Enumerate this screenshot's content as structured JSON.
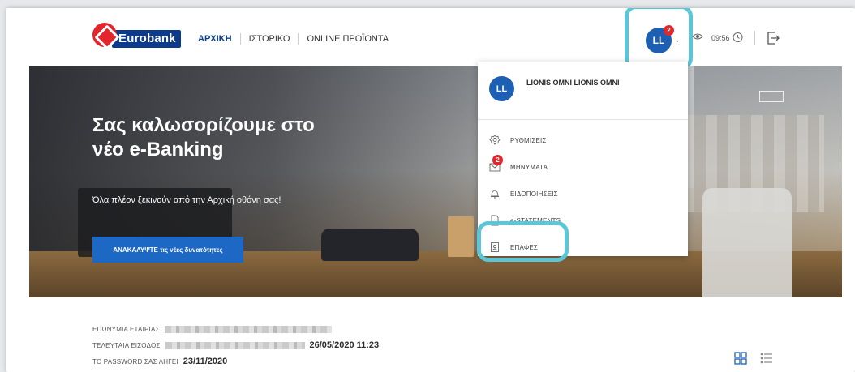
{
  "header": {
    "logo_text": "Eurobank",
    "nav": [
      "ΑΡΧΙΚΗ",
      "ΙΣΤΟΡΙΚΟ",
      "ONLINE ΠΡΟΪΟΝΤΑ"
    ],
    "user_initials": "LL",
    "notification_count": "2",
    "session_time": "09:56"
  },
  "hero": {
    "title": "Σας καλωσορίζουμε στο νέο e-Banking",
    "subtitle": "Όλα πλέον ξεκινούν από την Αρχική οθόνη σας!",
    "cta_label": "ΑΝΑΚΑΛΥΨΤΕ τις νέες δυνατότητες"
  },
  "user_menu": {
    "initials": "LL",
    "name": "LIONIS OMNI LIONIS OMNI",
    "items": [
      {
        "label": "ΡΥΘΜΙΣΕΙΣ",
        "icon": "gear-icon"
      },
      {
        "label": "ΜΗΝΥΜΑΤΑ",
        "icon": "envelope-icon",
        "badge": "2"
      },
      {
        "label": "ΕΙΔΟΠΟΙΗΣΕΙΣ",
        "icon": "bell-icon"
      },
      {
        "label": "e-STATEMENTS",
        "icon": "document-icon"
      },
      {
        "label": "ΕΠΑΦΕΣ",
        "icon": "contacts-icon"
      }
    ]
  },
  "account_info": {
    "company_label": "ΕΠΩΝΥΜΙΑ ΕΤΑΙΡΙΑΣ",
    "last_login_label": "ΤΕΛΕΥΤΑΙΑ ΕΙΣΟΔΟΣ",
    "last_login_value": "26/05/2020 11:23",
    "password_label": "ΤΟ PASSWORD ΣΑΣ ΛΗΓΕΙ",
    "password_value": "23/11/2020"
  },
  "colors": {
    "brand_blue": "#0c3b8b",
    "brand_red": "#e3262b",
    "highlight": "#5ac6d8",
    "button_blue": "#1d68c4"
  }
}
